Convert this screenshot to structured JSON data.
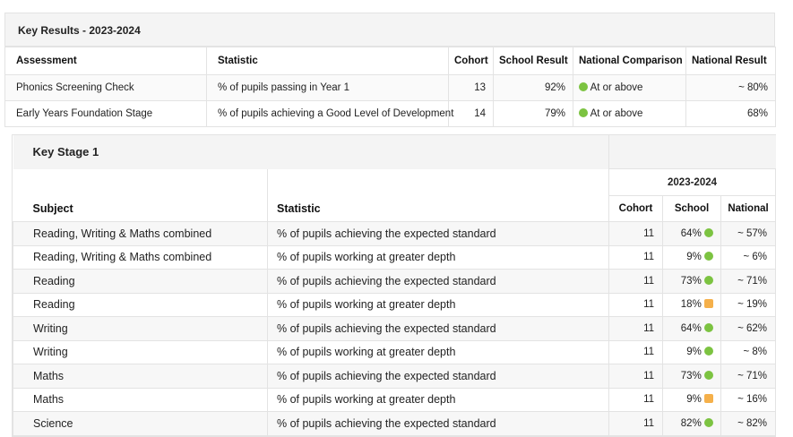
{
  "key_results": {
    "title": "Key Results - 2023-2024",
    "headers": [
      "Assessment",
      "Statistic",
      "Cohort",
      "School Result",
      "National Comparison",
      "National Result"
    ],
    "rows": [
      {
        "assessment": "Phonics Screening Check",
        "statistic": "% of pupils passing in Year 1",
        "cohort": "13",
        "school": "92%",
        "comparison": "At or above",
        "national": "~ 80%"
      },
      {
        "assessment": "Early Years Foundation Stage",
        "statistic": "% of pupils achieving a Good Level of Development",
        "cohort": "14",
        "school": "79%",
        "comparison": "At or above",
        "national": "68%"
      }
    ]
  },
  "key_stage_1": {
    "title": "Key Stage 1",
    "year": "2023-2024",
    "headers": {
      "subject": "Subject",
      "statistic": "Statistic",
      "cohort": "Cohort",
      "school": "School",
      "national": "National"
    },
    "rows": [
      {
        "subject": "Reading, Writing & Maths combined",
        "statistic": "% of pupils achieving the expected standard",
        "cohort": "11",
        "school": "64%",
        "indicator": "green",
        "national": "~ 57%"
      },
      {
        "subject": "Reading, Writing & Maths combined",
        "statistic": "% of pupils working at greater depth",
        "cohort": "11",
        "school": "9%",
        "indicator": "green",
        "national": "~ 6%"
      },
      {
        "subject": "Reading",
        "statistic": "% of pupils achieving the expected standard",
        "cohort": "11",
        "school": "73%",
        "indicator": "green",
        "national": "~ 71%"
      },
      {
        "subject": "Reading",
        "statistic": "% of pupils working at greater depth",
        "cohort": "11",
        "school": "18%",
        "indicator": "amber",
        "national": "~ 19%"
      },
      {
        "subject": "Writing",
        "statistic": "% of pupils achieving the expected standard",
        "cohort": "11",
        "school": "64%",
        "indicator": "green",
        "national": "~ 62%"
      },
      {
        "subject": "Writing",
        "statistic": "% of pupils working at greater depth",
        "cohort": "11",
        "school": "9%",
        "indicator": "green",
        "national": "~ 8%"
      },
      {
        "subject": "Maths",
        "statistic": "% of pupils achieving the expected standard",
        "cohort": "11",
        "school": "73%",
        "indicator": "green",
        "national": "~ 71%"
      },
      {
        "subject": "Maths",
        "statistic": "% of pupils working at greater depth",
        "cohort": "11",
        "school": "9%",
        "indicator": "amber",
        "national": "~ 16%"
      },
      {
        "subject": "Science",
        "statistic": "% of pupils achieving the expected standard",
        "cohort": "11",
        "school": "82%",
        "indicator": "green",
        "national": "~ 82%"
      }
    ]
  },
  "colors": {
    "green": "#7cc341",
    "amber": "#f5b04a"
  }
}
